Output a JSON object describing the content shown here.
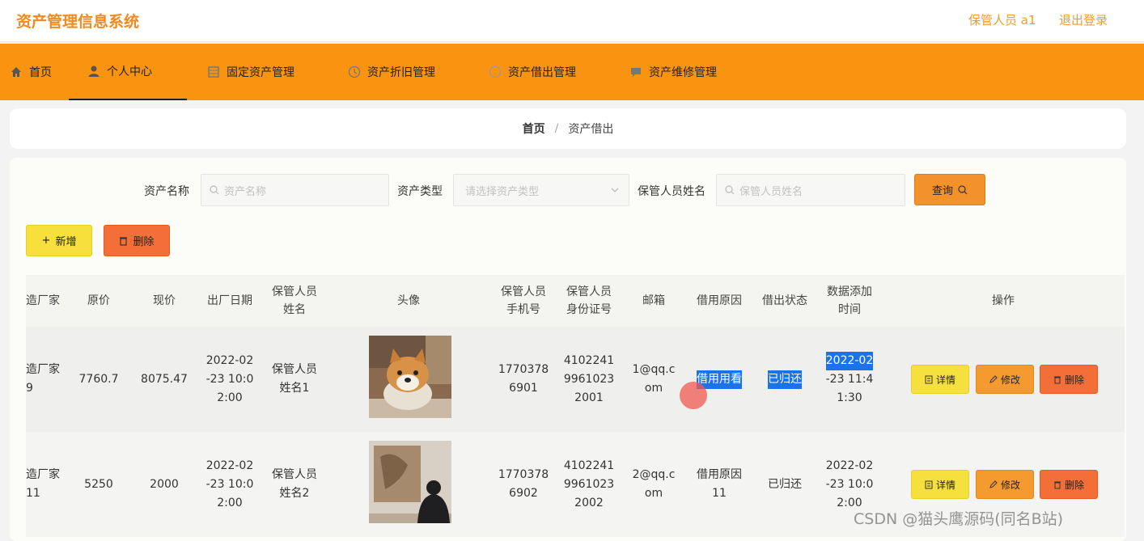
{
  "header": {
    "title": "资产管理信息系统",
    "user": "保管人员 a1",
    "logout": "退出登录"
  },
  "nav": {
    "items": [
      {
        "label": "首页",
        "icon": "home-icon"
      },
      {
        "label": "个人中心",
        "icon": "user-icon"
      },
      {
        "label": "固定资产管理",
        "icon": "grid-icon"
      },
      {
        "label": "资产折旧管理",
        "icon": "clock-icon"
      },
      {
        "label": "资产借出管理",
        "icon": "circle-icon"
      },
      {
        "label": "资产维修管理",
        "icon": "chat-icon"
      }
    ],
    "active_index": 1
  },
  "breadcrumb": {
    "home": "首页",
    "separator": "/",
    "current": "资产借出"
  },
  "search": {
    "asset_name_label": "资产名称",
    "asset_name_placeholder": "资产名称",
    "asset_type_label": "资产类型",
    "asset_type_placeholder": "请选择资产类型",
    "keeper_name_label": "保管人员姓名",
    "keeper_name_placeholder": "保管人员姓名",
    "query_button": "查询"
  },
  "actions": {
    "add": "新增",
    "delete": "删除"
  },
  "table": {
    "columns": [
      "造厂家",
      "原价",
      "现价",
      "出厂日期",
      "保管人员\n姓名",
      "头像",
      "保管人员\n手机号",
      "保管人员\n身份证号",
      "邮箱",
      "借用原因",
      "借出状态",
      "数据添加\n时间",
      "操作"
    ],
    "rows": [
      {
        "manufacturer": "造厂家\n9",
        "original_price": "7760.7",
        "current_price": "8075.47",
        "factory_date": "2022-02\n-23 10:0\n2:00",
        "keeper_name": "保管人员\n姓名1",
        "avatar": "shiba-dog-photo",
        "phone": "1770378\n6901",
        "id_number": "4102241\n9961023\n2001",
        "email": "1@qq.c\nom",
        "reason": "借用用看",
        "status": "已归还",
        "added_time_1": "2022-02",
        "added_time_2": "-23 11:4\n1:30"
      },
      {
        "manufacturer": "造厂家\n11",
        "original_price": "5250",
        "current_price": "2000",
        "factory_date": "2022-02\n-23 10:0\n2:00",
        "keeper_name": "保管人员\n姓名2",
        "avatar": "person-photo",
        "phone": "1770378\n6902",
        "id_number": "4102241\n9961023\n2002",
        "email": "2@qq.c\nom",
        "reason": "借用原因\n11",
        "status": "已归还",
        "added_time": "2022-02\n-23 10:0\n2:00"
      }
    ],
    "row_actions": {
      "detail": "详情",
      "edit": "修改",
      "delete": "删除"
    }
  },
  "watermark": "CSDN @猫头鹰源码(同名B站)",
  "colors": {
    "brand": "#f08a1c",
    "nav_bg": "#fa9410",
    "highlight": "#1a73e8"
  }
}
